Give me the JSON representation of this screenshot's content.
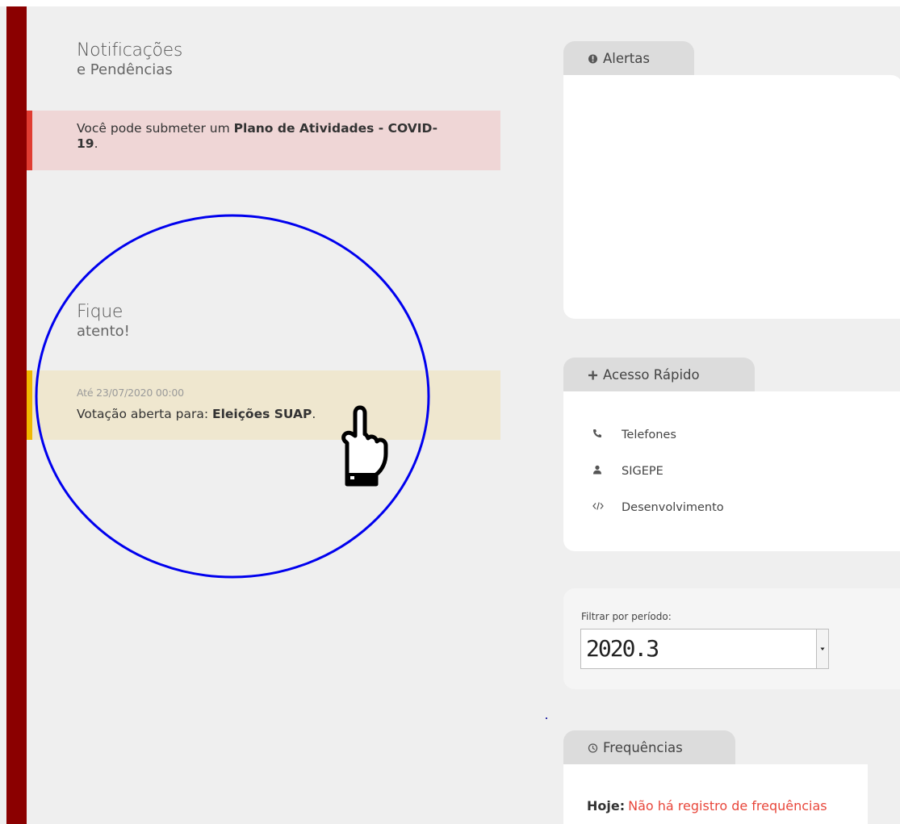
{
  "notificacoes": {
    "title_line1": "Notificações",
    "title_line2": "e Pendências",
    "notice": {
      "text_before": "Você pode submeter um ",
      "link_text": "Plano de Atividades - COVID-19",
      "text_after": "."
    }
  },
  "fique_atento": {
    "title_line1": "Fique",
    "title_line2": "atento!",
    "notice": {
      "date": "Até 23/07/2020 00:00",
      "text_before": "Votação aberta para: ",
      "link_text": "Eleições SUAP",
      "text_after": "."
    }
  },
  "alertas": {
    "tab_label": "Alertas",
    "icon": "exclamation-circle-icon"
  },
  "acesso_rapido": {
    "tab_label": "Acesso Rápido",
    "icon": "plus-icon",
    "items": [
      {
        "label": "Telefones",
        "icon": "phone-icon"
      },
      {
        "label": "SIGEPE",
        "icon": "user-icon"
      },
      {
        "label": "Desenvolvimento",
        "icon": "code-icon"
      }
    ]
  },
  "filtro": {
    "label": "Filtrar por período:",
    "selected": "2020.3"
  },
  "frequencias": {
    "tab_label": "Frequências",
    "icon": "clock-icon",
    "hoje_label": "Hoje:",
    "hoje_status": "Não há registro de frequências"
  },
  "colors": {
    "sidebar": "#8b0000",
    "danger_border": "#e03c31",
    "danger_bg": "#efd6d6",
    "warning_border": "#f0b800",
    "warning_bg": "#efe7cf",
    "annotation_circle": "#0000ee",
    "status_red": "#e8473b"
  },
  "annotation": {
    "shape": "circle",
    "cursor": "pointing-hand-icon"
  }
}
